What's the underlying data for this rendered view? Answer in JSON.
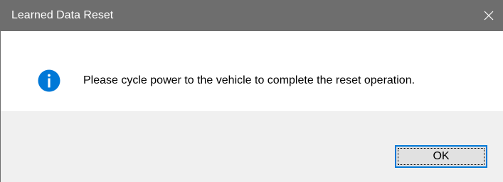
{
  "window": {
    "title": "Learned Data Reset",
    "close_icon": "close-icon",
    "title_bar_color": "#6e6e6e"
  },
  "message": {
    "icon": "info-icon",
    "icon_color": "#0078d7",
    "text": "Please cycle power to the vehicle to complete the reset operation."
  },
  "buttons": {
    "ok_label": "OK",
    "accent_color": "#0078d7"
  }
}
